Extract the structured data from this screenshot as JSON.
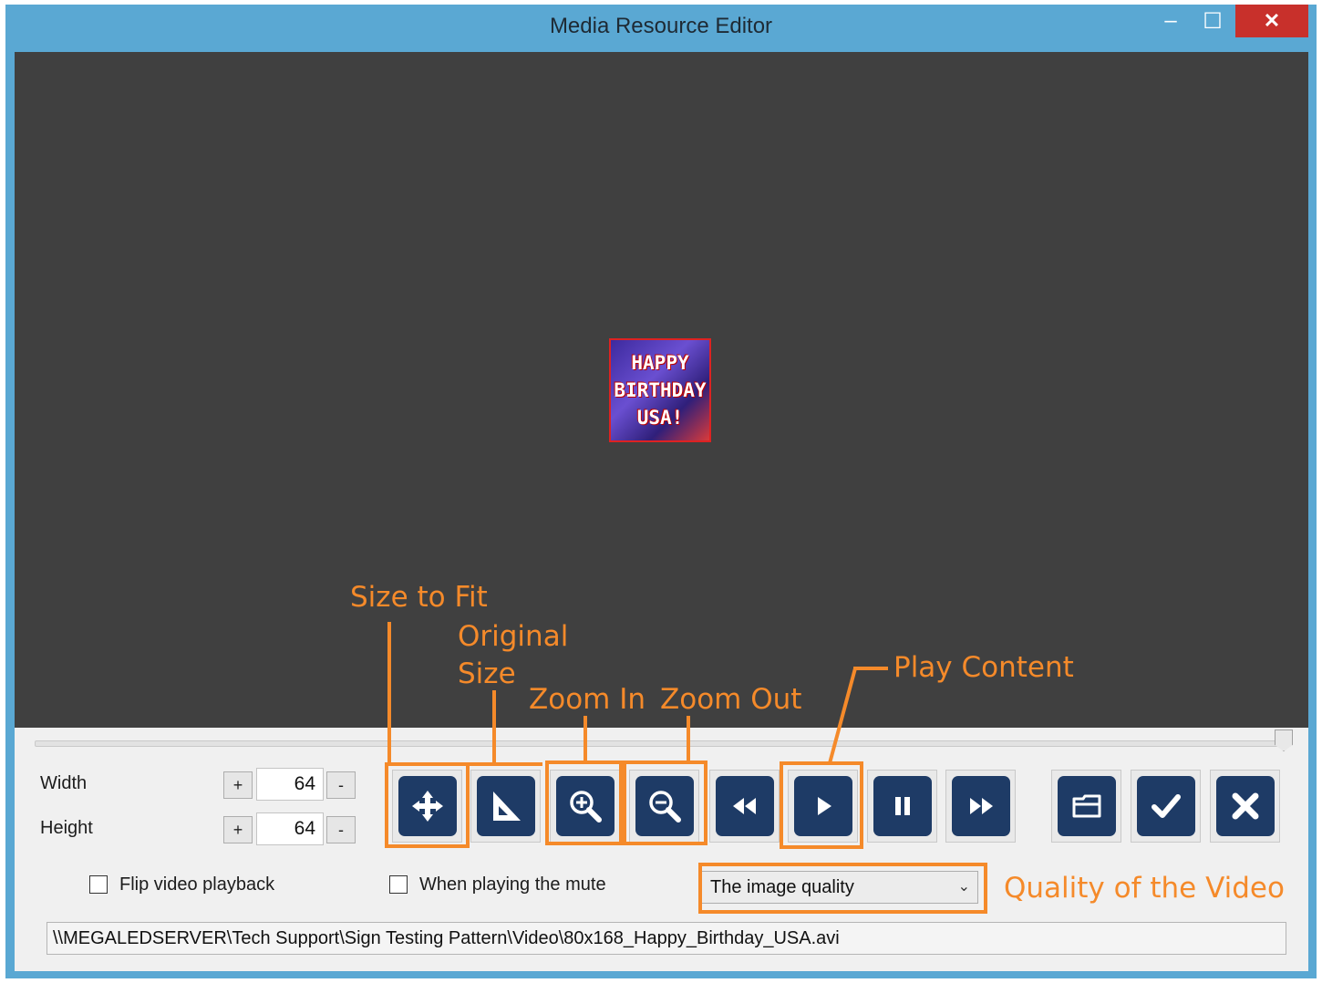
{
  "window": {
    "title": "Media Resource Editor",
    "controls": {
      "minimize": "–",
      "maximize": "☐",
      "close": "✕"
    }
  },
  "preview": {
    "thumbnail_lines": [
      "HAPPY",
      "BIRTHDAY",
      "USA!"
    ]
  },
  "annotations": {
    "size_to_fit": "Size to Fit",
    "original_size_line1": "Original",
    "original_size_line2": "Size",
    "zoom_in": "Zoom In",
    "zoom_out": "Zoom Out",
    "play_content": "Play Content",
    "quality": "Quality of the Video",
    "color": "#f58a2a"
  },
  "seek": {
    "position": 1.0
  },
  "dimensions": {
    "width_label": "Width",
    "height_label": "Height",
    "width_value": "64",
    "height_value": "64",
    "plus": "+",
    "minus": "-"
  },
  "toolbar": {
    "buttons": [
      {
        "name": "size-to-fit",
        "icon": "move-arrows-icon"
      },
      {
        "name": "original-size",
        "icon": "set-square-icon"
      },
      {
        "name": "zoom-in",
        "icon": "zoom-in-icon"
      },
      {
        "name": "zoom-out",
        "icon": "zoom-out-icon"
      },
      {
        "name": "rewind",
        "icon": "rewind-icon"
      },
      {
        "name": "play",
        "icon": "play-icon"
      },
      {
        "name": "pause",
        "icon": "pause-icon"
      },
      {
        "name": "fast-forward",
        "icon": "fast-forward-icon"
      },
      {
        "name": "open-folder",
        "icon": "folder-icon"
      },
      {
        "name": "confirm",
        "icon": "check-icon"
      },
      {
        "name": "cancel",
        "icon": "close-icon"
      }
    ],
    "button_color": "#1e3b66"
  },
  "options": {
    "flip_label": "Flip video playback",
    "flip_checked": false,
    "mute_label": "When playing the mute",
    "mute_checked": false,
    "quality_selected": "The image quality"
  },
  "file_path": "\\\\MEGALEDSERVER\\Tech Support\\Sign Testing Pattern\\Video\\80x168_Happy_Birthday_USA.avi"
}
